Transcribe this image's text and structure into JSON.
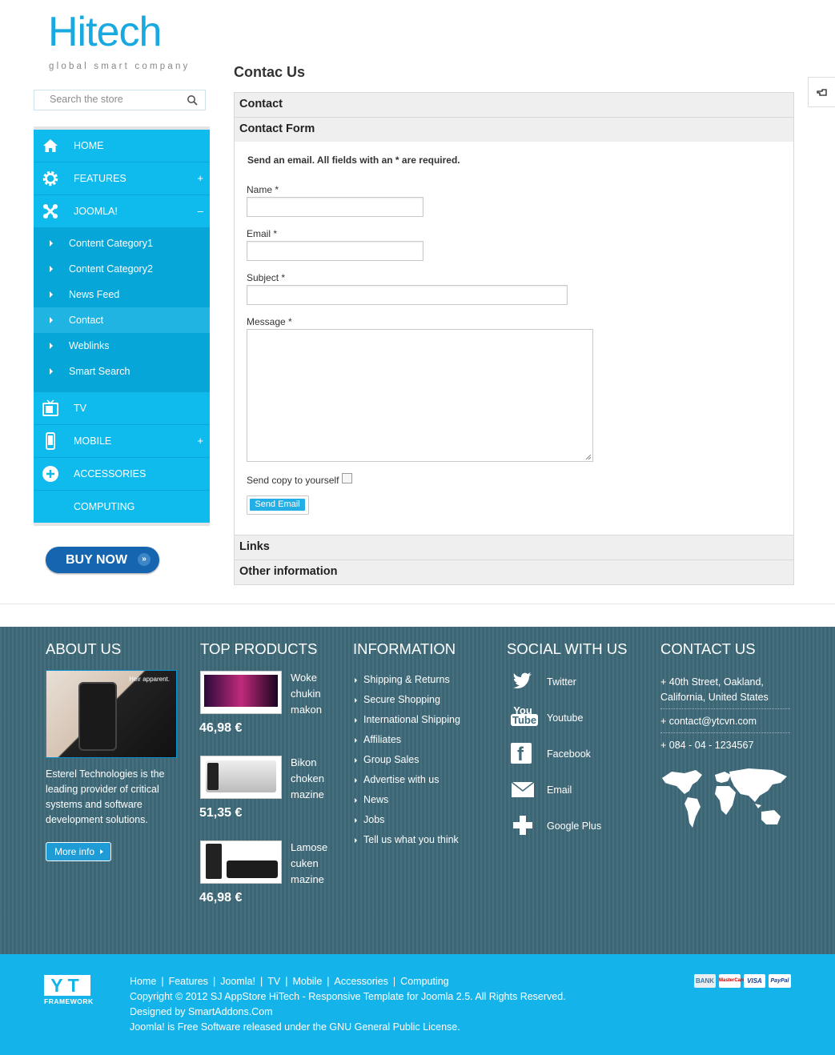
{
  "logo": {
    "main": "Hitech",
    "tagline": "global smart company"
  },
  "search": {
    "placeholder": "Search the store"
  },
  "nav": {
    "home": "HOME",
    "features": "FEATURES",
    "joomla": "JOOMLA!",
    "joomla_sub": [
      "Content Category1",
      "Content Category2",
      "News Feed",
      "Contact",
      "Weblinks",
      "Smart Search"
    ],
    "tv": "TV",
    "mobile": "MOBILE",
    "accessories": "ACCESSORIES",
    "computing": "COMPUTING",
    "plus": "+",
    "minus": "–"
  },
  "buy_now": "BUY NOW",
  "page_title": "Contac Us",
  "panels": {
    "contact": "Contact",
    "contact_form": "Contact Form",
    "links": "Links",
    "other": "Other information"
  },
  "form": {
    "note": "Send an email. All fields with an * are required.",
    "name_label": "Name *",
    "email_label": "Email *",
    "subject_label": "Subject *",
    "message_label": "Message *",
    "copy_label": "Send copy to yourself",
    "send_button": "Send Email"
  },
  "footer": {
    "about": {
      "title": "ABOUT US",
      "image_caption": "Heir apparent.",
      "text": "Esterel Technologies is the leading provider of critical systems and software development solutions.",
      "more": "More info"
    },
    "top_products": {
      "title": "TOP PRODUCTS",
      "items": [
        {
          "name_lines": [
            "Woke",
            "chukin",
            "makon"
          ],
          "price": "46,98 €"
        },
        {
          "name_lines": [
            "Bikon",
            "choken",
            "mazine"
          ],
          "price": "51,35 €"
        },
        {
          "name_lines": [
            "Lamose",
            "cuken",
            "mazine"
          ],
          "price": "46,98 €"
        }
      ]
    },
    "information": {
      "title": "INFORMATION",
      "items": [
        "Shipping & Returns",
        "Secure Shopping",
        "International Shipping",
        "Affiliates",
        "Group Sales",
        "Advertise with us",
        "News",
        "Jobs",
        "Tell us what you think"
      ]
    },
    "social": {
      "title": "SOCIAL WITH US",
      "items": [
        {
          "label": "Twitter",
          "icon": "twitter-icon"
        },
        {
          "label": "Youtube",
          "icon": "youtube-icon"
        },
        {
          "label": "Facebook",
          "icon": "facebook-icon"
        },
        {
          "label": "Email",
          "icon": "email-icon"
        },
        {
          "label": "Google Plus",
          "icon": "google-plus-icon"
        }
      ]
    },
    "contact": {
      "title": "CONTACT US",
      "address": "+ 40th Street, Oakland, California, United States",
      "email": "+ contact@ytcvn.com",
      "phone": "+ 084 - 04 - 1234567"
    }
  },
  "bottom": {
    "yt_logo": "YT",
    "yt_sub": "FRAMEWORK",
    "links": [
      "Home",
      "Features",
      "Joomla!",
      "TV",
      "Mobile",
      "Accessories",
      "Computing"
    ],
    "copyright": "Copyright © 2012 SJ AppStore HiTech - Responsive Template for Joomla 2.5. All Rights Reserved.",
    "designed": "Designed by SmartAddons.Com",
    "license": "Joomla! is Free Software released under the GNU General Public License.",
    "cards": [
      "BANK",
      "MasterCard",
      "VISA",
      "PayPal"
    ]
  },
  "colors": {
    "accent": "#0fbaec",
    "footer_dark": "#3f6a7a",
    "buy_button": "#1565b0"
  }
}
